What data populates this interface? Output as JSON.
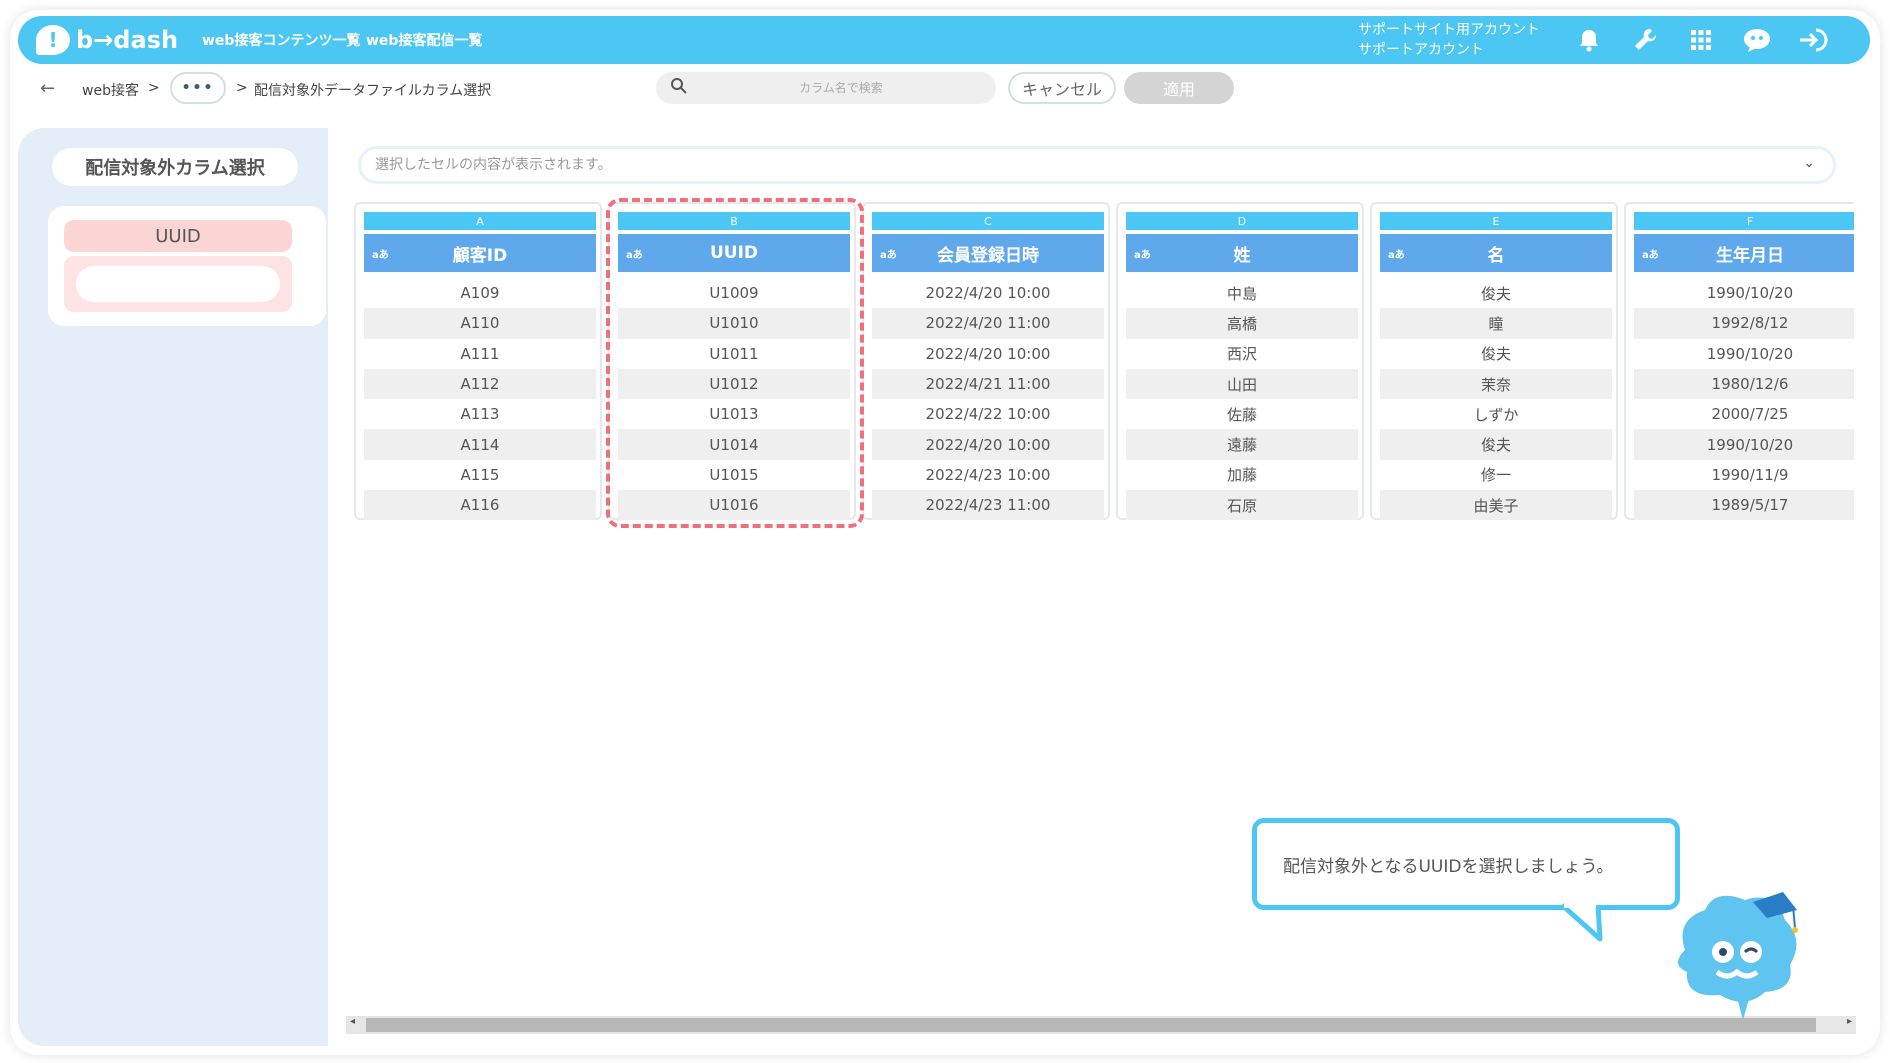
{
  "app": {
    "logo_text": "b→dash"
  },
  "header": {
    "nav": [
      "web接客コンテンツ一覧",
      "web接客配信一覧"
    ],
    "account_line1": "サポートサイト用アカウント",
    "account_line2": "サポートアカウント",
    "icons": [
      "bell-icon",
      "wrench-icon",
      "grid-icon",
      "chat-robot-icon",
      "logout-icon"
    ]
  },
  "toolbar": {
    "breadcrumb_root": "web接客",
    "breadcrumb_sep": ">",
    "breadcrumb_more": "•••",
    "breadcrumb_current": "配信対象外データファイルカラム選択",
    "search_placeholder": "カラム名で検索",
    "cancel_label": "キャンセル",
    "apply_label": "適用"
  },
  "left_panel": {
    "title": "配信対象外カラム選択",
    "selected_item": "UUID"
  },
  "main": {
    "cell_display_placeholder": "選択したセルの内容が表示されます。",
    "type_badge": "aあ",
    "columns": [
      {
        "letter": "A",
        "name": "顧客ID",
        "cells": [
          "A109",
          "A110",
          "A111",
          "A112",
          "A113",
          "A114",
          "A115",
          "A116"
        ]
      },
      {
        "letter": "B",
        "name": "UUID",
        "cells": [
          "U1009",
          "U1010",
          "U1011",
          "U1012",
          "U1013",
          "U1014",
          "U1015",
          "U1016"
        ]
      },
      {
        "letter": "C",
        "name": "会員登録日時",
        "cells": [
          "2022/4/20 10:00",
          "2022/4/20 11:00",
          "2022/4/20 10:00",
          "2022/4/21 11:00",
          "2022/4/22 10:00",
          "2022/4/20 10:00",
          "2022/4/23 10:00",
          "2022/4/23 11:00"
        ]
      },
      {
        "letter": "D",
        "name": "姓",
        "cells": [
          "中島",
          "高橋",
          "西沢",
          "山田",
          "佐藤",
          "遠藤",
          "加藤",
          "石原"
        ]
      },
      {
        "letter": "E",
        "name": "名",
        "cells": [
          "俊夫",
          "瞳",
          "俊夫",
          "茉奈",
          "しずか",
          "俊夫",
          "修一",
          "由美子"
        ]
      },
      {
        "letter": "F",
        "name": "生年月日",
        "cells": [
          "1990/10/20",
          "1992/8/12",
          "1990/10/20",
          "1980/12/6",
          "2000/7/25",
          "1990/10/20",
          "1990/11/9",
          "1989/5/17"
        ]
      }
    ]
  },
  "tooltip": {
    "text": "配信対象外となるUUIDを選択しましょう。"
  },
  "colors": {
    "primary": "#4cc6f3",
    "header_blue": "#5fa8ec",
    "highlight": "#ef6f7b",
    "panel": "#e3eef8"
  }
}
